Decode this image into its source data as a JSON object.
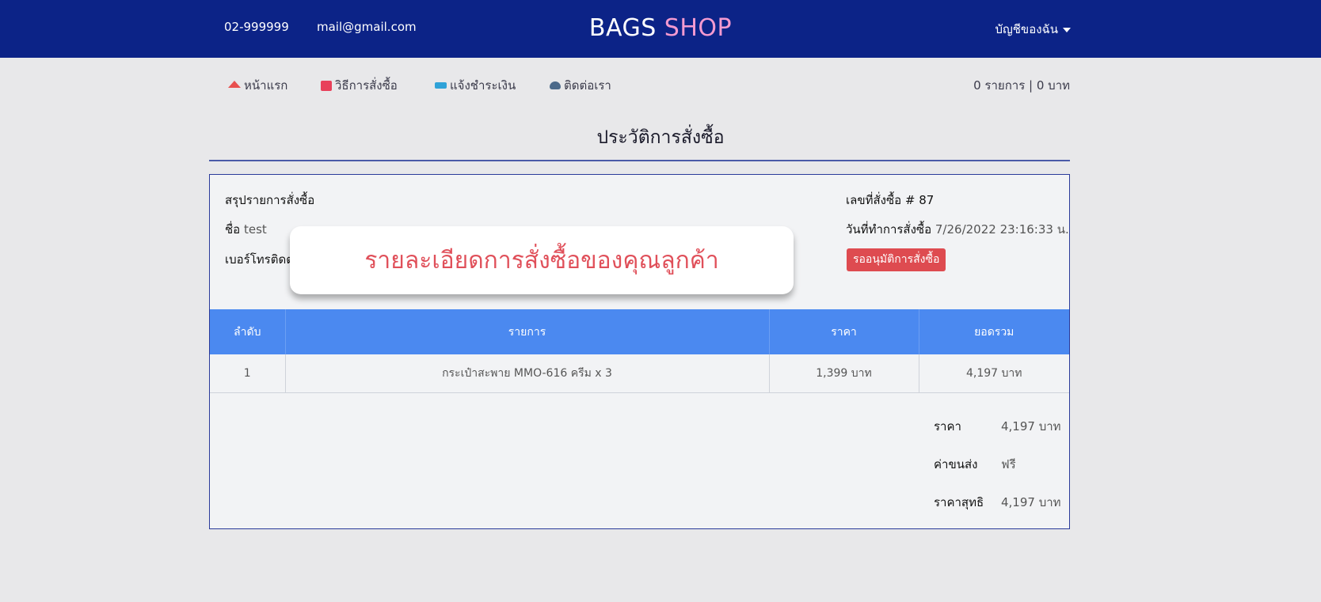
{
  "header": {
    "phone": "02-999999",
    "email": "mail@gmail.com",
    "brand_part1": "BAGS",
    "brand_part2": "SHOP",
    "account_label": "บัญชีของฉัน"
  },
  "nav": {
    "items": [
      {
        "label": "หน้าแรก",
        "icon": "home-icon"
      },
      {
        "label": "วิธีการสั่งซื้อ",
        "icon": "bag-icon"
      },
      {
        "label": "แจ้งชำระเงิน",
        "icon": "card-icon"
      },
      {
        "label": "ติดต่อเรา",
        "icon": "phone-icon"
      }
    ],
    "cart_summary": "0 รายการ | 0 บาท"
  },
  "page": {
    "title": "ประวัติการสั่งซื้อ"
  },
  "order": {
    "summary_label": "สรุปรายการสั่งซื้อ",
    "name_label": "ชื่อ",
    "name_value": "test",
    "tel_label": "เบอร์โทรติดต่",
    "order_no_label": "เลขที่สั่งซื้อ # 87",
    "date_label": "วันที่ทำการสั่งซื้อ",
    "date_value": "7/26/2022 23:16:33 น.",
    "status": "รออนุมัติการสั่งซื้อ"
  },
  "callout": {
    "text": "รายละเอียดการสั่งซื้อของคุณลูกค้า"
  },
  "table": {
    "headers": [
      "ลำดับ",
      "รายการ",
      "ราคา",
      "ยอดรวม"
    ],
    "rows": [
      [
        "1",
        "กระเป๋าสะพาย MMO-616 ครีม x 3",
        "1,399 บาท",
        "4,197 บาท"
      ]
    ]
  },
  "totals": {
    "price_label": "ราคา",
    "price_value": "4,197 บาท",
    "shipping_label": "ค่าขนส่ง",
    "shipping_value": "ฟรี",
    "net_label": "ราคาสุทธิ",
    "net_value": "4,197 บาท"
  },
  "colors": {
    "header_bg": "#0c2387",
    "brand_accent": "#f49ad0",
    "table_header": "#4b89f0",
    "status_badge": "#de4b50"
  }
}
